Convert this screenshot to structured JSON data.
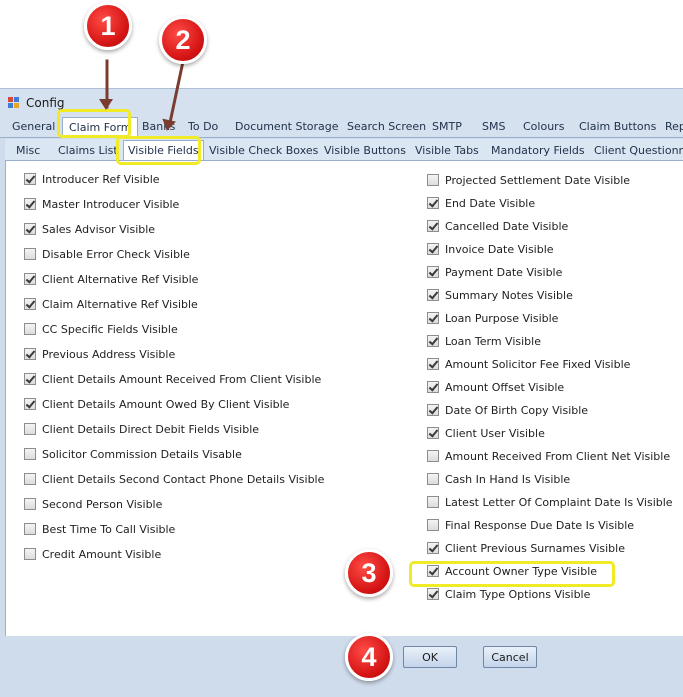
{
  "window": {
    "title": "Config"
  },
  "main_tabs": [
    {
      "label": "General"
    },
    {
      "label": "Claim Form"
    },
    {
      "label": "Banks"
    },
    {
      "label": "To Do"
    },
    {
      "label": "Document Storage"
    },
    {
      "label": "Search Screen"
    },
    {
      "label": "SMTP"
    },
    {
      "label": "SMS"
    },
    {
      "label": "Colours"
    },
    {
      "label": "Claim Buttons"
    },
    {
      "label": "Rep"
    }
  ],
  "sub_tabs": [
    {
      "label": "Misc"
    },
    {
      "label": "Claims List"
    },
    {
      "label": "Visible Fields"
    },
    {
      "label": "Visible Check Boxes"
    },
    {
      "label": "Visible Buttons"
    },
    {
      "label": "Visible Tabs"
    },
    {
      "label": "Mandatory Fields"
    },
    {
      "label": "Client Questionnai"
    }
  ],
  "left_fields": [
    {
      "label": "Introducer Ref Visible",
      "checked": true
    },
    {
      "label": "Master Introducer Visible",
      "checked": true
    },
    {
      "label": "Sales Advisor Visible",
      "checked": true
    },
    {
      "label": "Disable Error Check Visible",
      "checked": false
    },
    {
      "label": "Client Alternative Ref Visible",
      "checked": true
    },
    {
      "label": "Claim Alternative Ref Visible",
      "checked": true
    },
    {
      "label": "CC Specific Fields Visible",
      "checked": false
    },
    {
      "label": "Previous Address Visible",
      "checked": true
    },
    {
      "label": "Client Details Amount Received From Client Visible",
      "checked": true
    },
    {
      "label": "Client Details Amount Owed By Client Visible",
      "checked": true
    },
    {
      "label": "Client Details Direct Debit Fields Visible",
      "checked": false
    },
    {
      "label": "Solicitor Commission Details Visable",
      "checked": false
    },
    {
      "label": "Client Details Second Contact Phone Details Visible",
      "checked": false
    },
    {
      "label": "Second Person Visible",
      "checked": false
    },
    {
      "label": "Best Time To Call Visible",
      "checked": false
    },
    {
      "label": "Credit Amount Visible",
      "checked": false
    }
  ],
  "right_fields": [
    {
      "label": "Projected Settlement Date Visible",
      "checked": false
    },
    {
      "label": "End Date Visible",
      "checked": true
    },
    {
      "label": "Cancelled Date Visible",
      "checked": true
    },
    {
      "label": " Invoice Date Visible",
      "checked": true
    },
    {
      "label": "Payment Date Visible",
      "checked": true
    },
    {
      "label": "Summary Notes Visible",
      "checked": true
    },
    {
      "label": "Loan Purpose Visible",
      "checked": true
    },
    {
      "label": "Loan Term Visible",
      "checked": true
    },
    {
      "label": "Amount Solicitor Fee Fixed Visible",
      "checked": true
    },
    {
      "label": "Amount Offset Visible",
      "checked": true
    },
    {
      "label": "Date Of Birth Copy Visible",
      "checked": true
    },
    {
      "label": "Client User Visible",
      "checked": true
    },
    {
      "label": "Amount Received From Client Net Visible",
      "checked": false
    },
    {
      "label": "Cash In Hand Is Visible",
      "checked": false
    },
    {
      "label": "Latest Letter Of Complaint Date Is Visible",
      "checked": false
    },
    {
      "label": "Final Response Due Date Is Visible",
      "checked": false
    },
    {
      "label": "Client Previous Surnames Visible",
      "checked": true
    },
    {
      "label": "Account Owner Type Visible",
      "checked": true
    },
    {
      "label": "Claim Type Options Visible",
      "checked": true
    }
  ],
  "buttons": {
    "ok": "OK",
    "cancel": "Cancel"
  },
  "annotations": {
    "step1": "1",
    "step2": "2",
    "step3": "3",
    "step4": "4",
    "marker_color": "#d41414",
    "highlight_color": "#f0ea27"
  }
}
